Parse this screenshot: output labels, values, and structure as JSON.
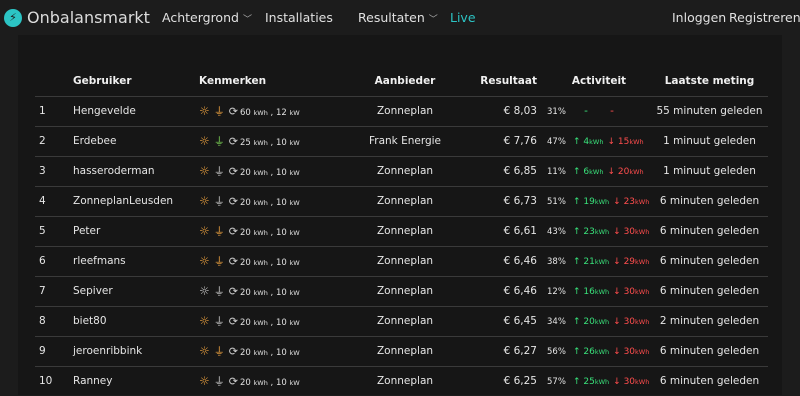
{
  "brand": {
    "name": "Onbalansmarkt"
  },
  "nav": {
    "achtergrond": "Achtergrond",
    "installaties": "Installaties",
    "resultaten": "Resultaten",
    "live": "Live",
    "login": "Inloggen",
    "register": "Registreren"
  },
  "table": {
    "headers": {
      "user": "Gebruiker",
      "kenmerken": "Kenmerken",
      "aanbieder": "Aanbieder",
      "resultaat": "Resultaat",
      "activiteit": "Activiteit",
      "laatste": "Laatste meting"
    },
    "kwh_unit": "kWh",
    "kw_unit": "kW",
    "rows": [
      {
        "rank": "1",
        "user": "Hengevelde",
        "cap": "60",
        "power": "12",
        "aanbieder": "Zonneplan",
        "resultaat": "€ 8,03",
        "pct": "31%",
        "up": "-",
        "down": "-",
        "laatste": "55 minuten geleden",
        "sun": "orange",
        "plug": "orange"
      },
      {
        "rank": "2",
        "user": "Erdebee",
        "cap": "25",
        "power": "10",
        "aanbieder": "Frank Energie",
        "resultaat": "€ 7,76",
        "pct": "47%",
        "up": "4",
        "down": "15",
        "laatste": "1 minuut geleden",
        "sun": "orange",
        "plug": "green"
      },
      {
        "rank": "3",
        "user": "hasseroderman",
        "cap": "20",
        "power": "10",
        "aanbieder": "Zonneplan",
        "resultaat": "€ 6,85",
        "pct": "11%",
        "up": "6",
        "down": "20",
        "laatste": "1 minuut geleden",
        "sun": "orange",
        "plug": "grey"
      },
      {
        "rank": "4",
        "user": "ZonneplanLeusden",
        "cap": "20",
        "power": "10",
        "aanbieder": "Zonneplan",
        "resultaat": "€ 6,73",
        "pct": "51%",
        "up": "19",
        "down": "23",
        "laatste": "6 minuten geleden",
        "sun": "orange",
        "plug": "grey"
      },
      {
        "rank": "5",
        "user": "Peter",
        "cap": "20",
        "power": "10",
        "aanbieder": "Zonneplan",
        "resultaat": "€ 6,61",
        "pct": "43%",
        "up": "23",
        "down": "30",
        "laatste": "6 minuten geleden",
        "sun": "orange",
        "plug": "orange"
      },
      {
        "rank": "6",
        "user": "rleefmans",
        "cap": "20",
        "power": "10",
        "aanbieder": "Zonneplan",
        "resultaat": "€ 6,46",
        "pct": "38%",
        "up": "21",
        "down": "29",
        "laatste": "6 minuten geleden",
        "sun": "orange",
        "plug": "orange"
      },
      {
        "rank": "7",
        "user": "Sepiver",
        "cap": "20",
        "power": "10",
        "aanbieder": "Zonneplan",
        "resultaat": "€ 6,46",
        "pct": "12%",
        "up": "16",
        "down": "30",
        "laatste": "6 minuten geleden",
        "sun": "grey",
        "plug": "grey"
      },
      {
        "rank": "8",
        "user": "biet80",
        "cap": "20",
        "power": "10",
        "aanbieder": "Zonneplan",
        "resultaat": "€ 6,45",
        "pct": "34%",
        "up": "20",
        "down": "30",
        "laatste": "2 minuten geleden",
        "sun": "orange",
        "plug": "grey"
      },
      {
        "rank": "9",
        "user": "jeroenribbink",
        "cap": "20",
        "power": "10",
        "aanbieder": "Zonneplan",
        "resultaat": "€ 6,27",
        "pct": "56%",
        "up": "26",
        "down": "30",
        "laatste": "6 minuten geleden",
        "sun": "orange",
        "plug": "orange"
      },
      {
        "rank": "10",
        "user": "Ranney",
        "cap": "20",
        "power": "10",
        "aanbieder": "Zonneplan",
        "resultaat": "€ 6,25",
        "pct": "57%",
        "up": "25",
        "down": "30",
        "laatste": "6 minuten geleden",
        "sun": "orange",
        "plug": "grey"
      }
    ]
  }
}
